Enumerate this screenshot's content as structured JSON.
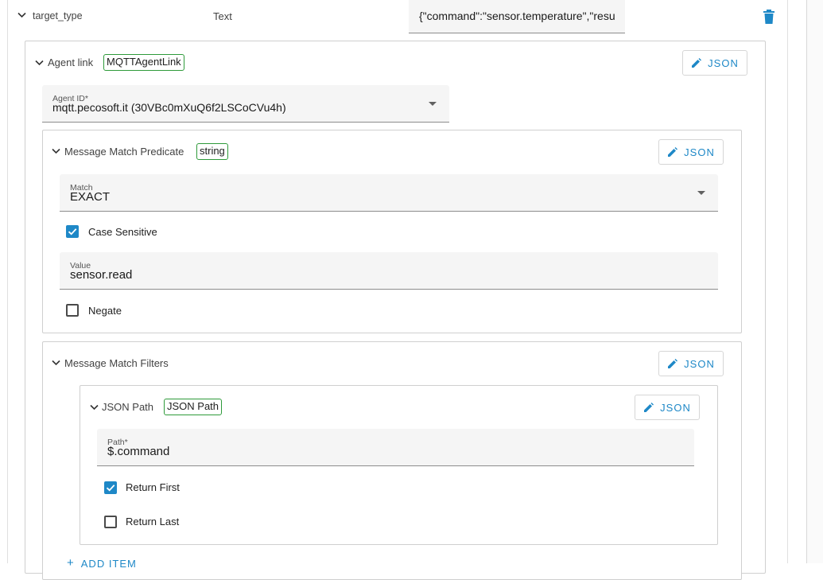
{
  "top_row": {
    "name": "target_type",
    "type": "Text",
    "value": "{\"command\":\"sensor.temperature\",\"resu"
  },
  "agent_link": {
    "label": "Agent link",
    "badge": "MQTTAgentLink",
    "json_label": "JSON",
    "agent_id": {
      "label": "Agent ID*",
      "value": "mqtt.pecosoft.it (30VBc0mXuQ6f2LSCoCVu4h)"
    }
  },
  "predicate": {
    "label": "Message Match Predicate",
    "badge": "string",
    "json_label": "JSON",
    "match": {
      "label": "Match",
      "value": "EXACT"
    },
    "case_sensitive": {
      "label": "Case Sensitive",
      "checked": true
    },
    "value_field": {
      "label": "Value",
      "value": "sensor.read"
    },
    "negate": {
      "label": "Negate",
      "checked": false
    }
  },
  "filters": {
    "label": "Message Match Filters",
    "json_label": "JSON",
    "json_path": {
      "label": "JSON Path",
      "badge": "JSON Path",
      "json_label": "JSON",
      "path": {
        "label": "Path*",
        "value": "$.command"
      },
      "return_first": {
        "label": "Return First",
        "checked": true
      },
      "return_last": {
        "label": "Return Last",
        "checked": false
      }
    },
    "add_item_label": "ADD ITEM"
  },
  "colors": {
    "accent": "#1e88c7",
    "badge_border": "#2e9a3a",
    "field_bg": "#f5f5f5",
    "panel_border": "#cfcfcf"
  }
}
